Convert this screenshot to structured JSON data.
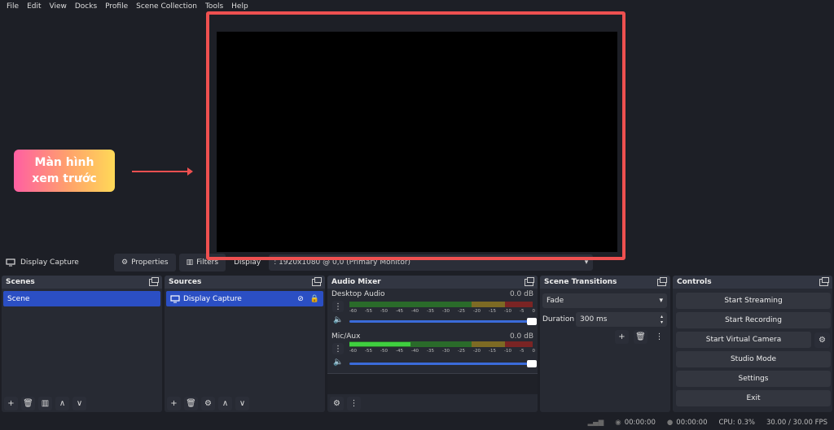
{
  "menu": [
    "File",
    "Edit",
    "View",
    "Docks",
    "Profile",
    "Scene Collection",
    "Tools",
    "Help"
  ],
  "callout": {
    "line1": "Màn hình",
    "line2": "xem trước"
  },
  "context_bar": {
    "source_name": "Display Capture",
    "properties_label": "Properties",
    "filters_label": "Filters",
    "display_label": "Display",
    "display_value": ": 1920x1080 @ 0,0 (Primary Monitor)"
  },
  "scenes": {
    "title": "Scenes",
    "items": [
      "Scene"
    ]
  },
  "sources": {
    "title": "Sources",
    "items": [
      "Display Capture"
    ]
  },
  "mixer": {
    "title": "Audio Mixer",
    "channels": [
      {
        "name": "Desktop Audio",
        "db": "0.0 dB"
      },
      {
        "name": "Mic/Aux",
        "db": "0.0 dB"
      }
    ],
    "ticks": [
      "-60",
      "-55",
      "-50",
      "-45",
      "-40",
      "-35",
      "-30",
      "-25",
      "-20",
      "-15",
      "-10",
      "-5",
      "0"
    ]
  },
  "transitions": {
    "title": "Scene Transitions",
    "selected": "Fade",
    "duration_label": "Duration",
    "duration_value": "300 ms"
  },
  "controls": {
    "title": "Controls",
    "start_streaming": "Start Streaming",
    "start_recording": "Start Recording",
    "start_virtual_camera": "Start Virtual Camera",
    "studio_mode": "Studio Mode",
    "settings": "Settings",
    "exit": "Exit"
  },
  "status": {
    "stream_time": "00:00:00",
    "record_time": "00:00:00",
    "cpu": "CPU: 0.3%",
    "fps": "30.00 / 30.00 FPS"
  },
  "colors": {
    "accent": "#2b4fc4",
    "frame": "#ee5050",
    "fader": "#3b6bd9"
  }
}
